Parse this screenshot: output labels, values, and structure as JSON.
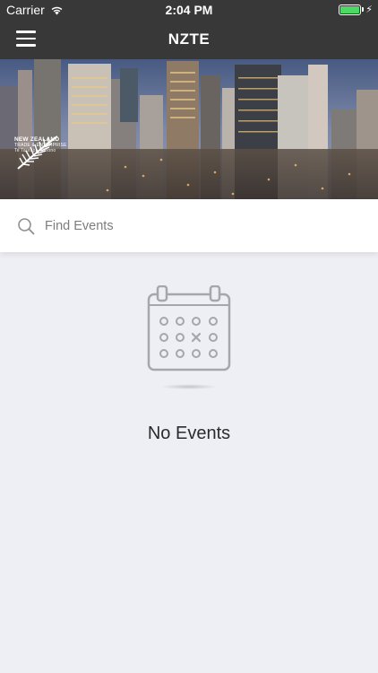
{
  "status_bar": {
    "carrier": "Carrier",
    "time": "2:04 PM",
    "battery_level": 1.0,
    "battery_color": "#4cd964"
  },
  "nav": {
    "title": "NZTE",
    "menu_icon": "hamburger-menu-icon"
  },
  "hero": {
    "logo": {
      "line1": "NEW ZEALAND",
      "line2": "TRADE & ENTERPRISE",
      "line3": "Te Taurapa Tūhono"
    }
  },
  "search": {
    "placeholder": "Find Events",
    "value": "",
    "icon": "search-icon"
  },
  "empty_state": {
    "icon": "calendar-icon",
    "message": "No Events"
  },
  "colors": {
    "nav_bg": "#383838",
    "page_bg": "#eeeff4",
    "icon_gray": "#a6a6ab"
  }
}
